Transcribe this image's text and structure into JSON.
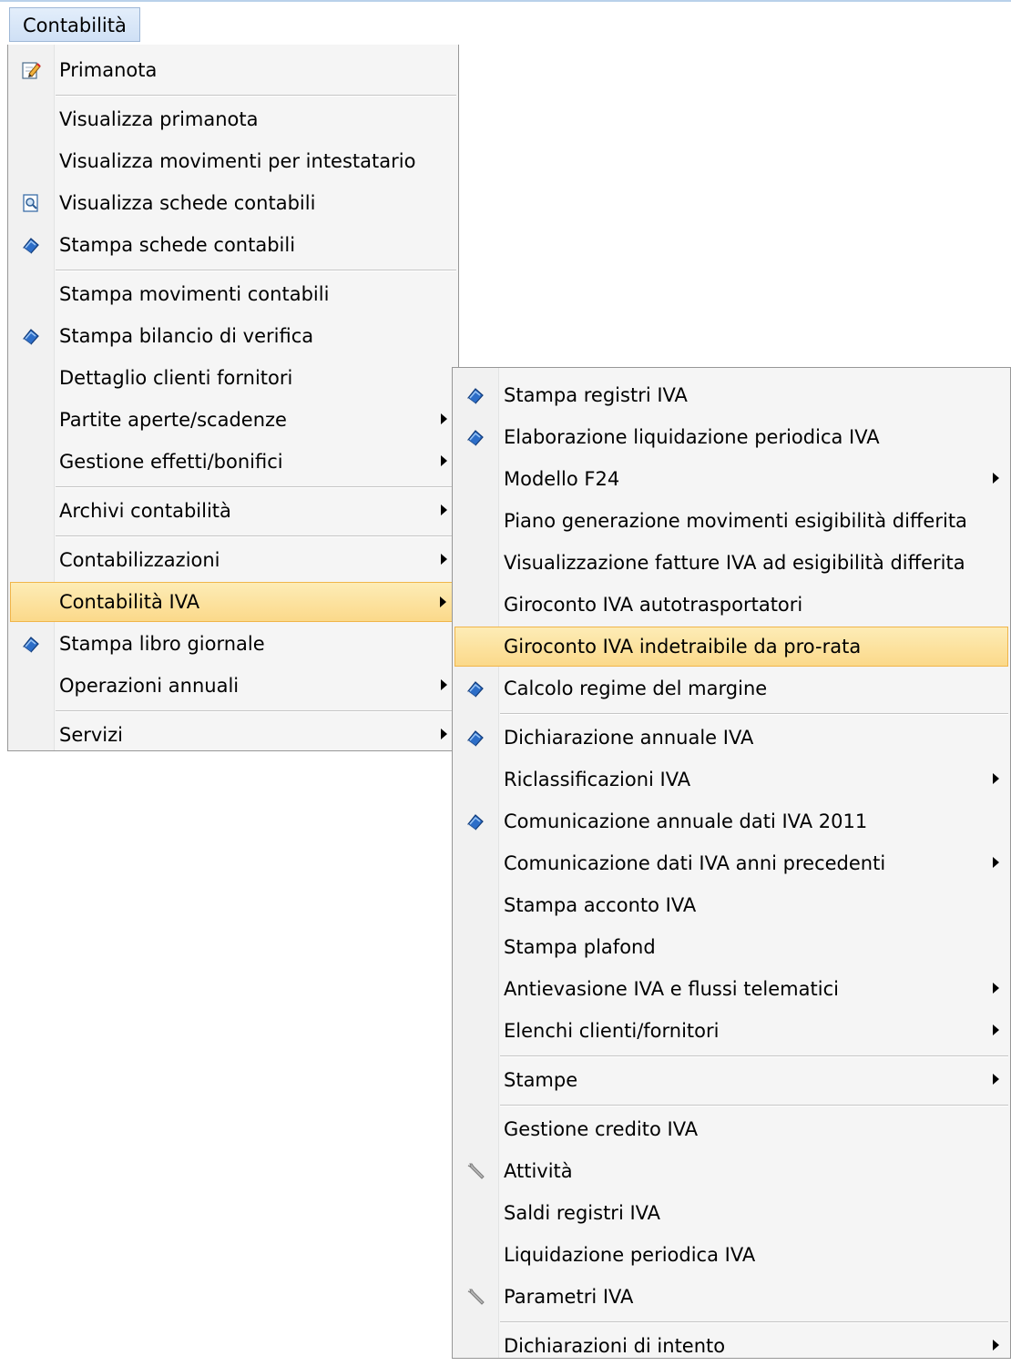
{
  "menubar": {
    "label": "Contabilità"
  },
  "main_menu": {
    "items": [
      {
        "label": "Primanota",
        "icon": "edit-note-icon"
      },
      {
        "label": "Visualizza primanota"
      },
      {
        "label": "Visualizza movimenti per intestatario"
      },
      {
        "label": "Visualizza schede contabili",
        "icon": "preview-document-icon"
      },
      {
        "label": "Stampa schede contabili",
        "icon": "print-book-icon"
      },
      {
        "label": "Stampa movimenti contabili"
      },
      {
        "label": "Stampa bilancio di verifica",
        "icon": "print-book-icon"
      },
      {
        "label": "Dettaglio clienti fornitori"
      },
      {
        "label": "Partite aperte/scadenze",
        "submenu": true
      },
      {
        "label": "Gestione effetti/bonifici",
        "submenu": true
      },
      {
        "label": "Archivi contabilità",
        "submenu": true
      },
      {
        "label": "Contabilizzazioni",
        "submenu": true
      },
      {
        "label": "Contabilità IVA",
        "submenu": true,
        "highlighted": true
      },
      {
        "label": "Stampa libro giornale",
        "icon": "print-book-icon"
      },
      {
        "label": "Operazioni annuali",
        "submenu": true
      },
      {
        "label": "Servizi",
        "submenu": true
      }
    ]
  },
  "sub_menu": {
    "items": [
      {
        "label": "Stampa registri IVA",
        "icon": "print-book-icon"
      },
      {
        "label": "Elaborazione liquidazione periodica IVA",
        "icon": "print-book-icon"
      },
      {
        "label": "Modello F24",
        "submenu": true
      },
      {
        "label": "Piano generazione movimenti esigibilità differita"
      },
      {
        "label": "Visualizzazione fatture IVA ad esigibilità differita"
      },
      {
        "label": "Giroconto IVA autotrasportatori"
      },
      {
        "label": "Giroconto IVA indetraibile da pro-rata",
        "highlighted": true
      },
      {
        "label": "Calcolo regime del margine",
        "icon": "print-book-icon"
      },
      {
        "label": "Dichiarazione annuale IVA",
        "icon": "print-book-icon"
      },
      {
        "label": "Riclassificazioni IVA",
        "submenu": true
      },
      {
        "label": "Comunicazione annuale dati IVA 2011",
        "icon": "print-book-icon"
      },
      {
        "label": "Comunicazione dati IVA anni precedenti",
        "submenu": true
      },
      {
        "label": "Stampa acconto IVA"
      },
      {
        "label": "Stampa plafond"
      },
      {
        "label": "Antievasione IVA e flussi telematici",
        "submenu": true
      },
      {
        "label": "Elenchi clienti/fornitori",
        "submenu": true
      },
      {
        "label": "Stampe",
        "submenu": true
      },
      {
        "label": "Gestione credito IVA"
      },
      {
        "label": "Attività",
        "icon": "wrench-icon"
      },
      {
        "label": "Saldi registri IVA"
      },
      {
        "label": "Liquidazione periodica IVA"
      },
      {
        "label": "Parametri IVA",
        "icon": "wrench-icon"
      },
      {
        "label": "Dichiarazioni di intento",
        "submenu": true
      }
    ]
  },
  "colors": {
    "highlight": "#fbd98a",
    "highlight_border": "#f0b54a",
    "menu_bg": "#f5f5f5"
  }
}
